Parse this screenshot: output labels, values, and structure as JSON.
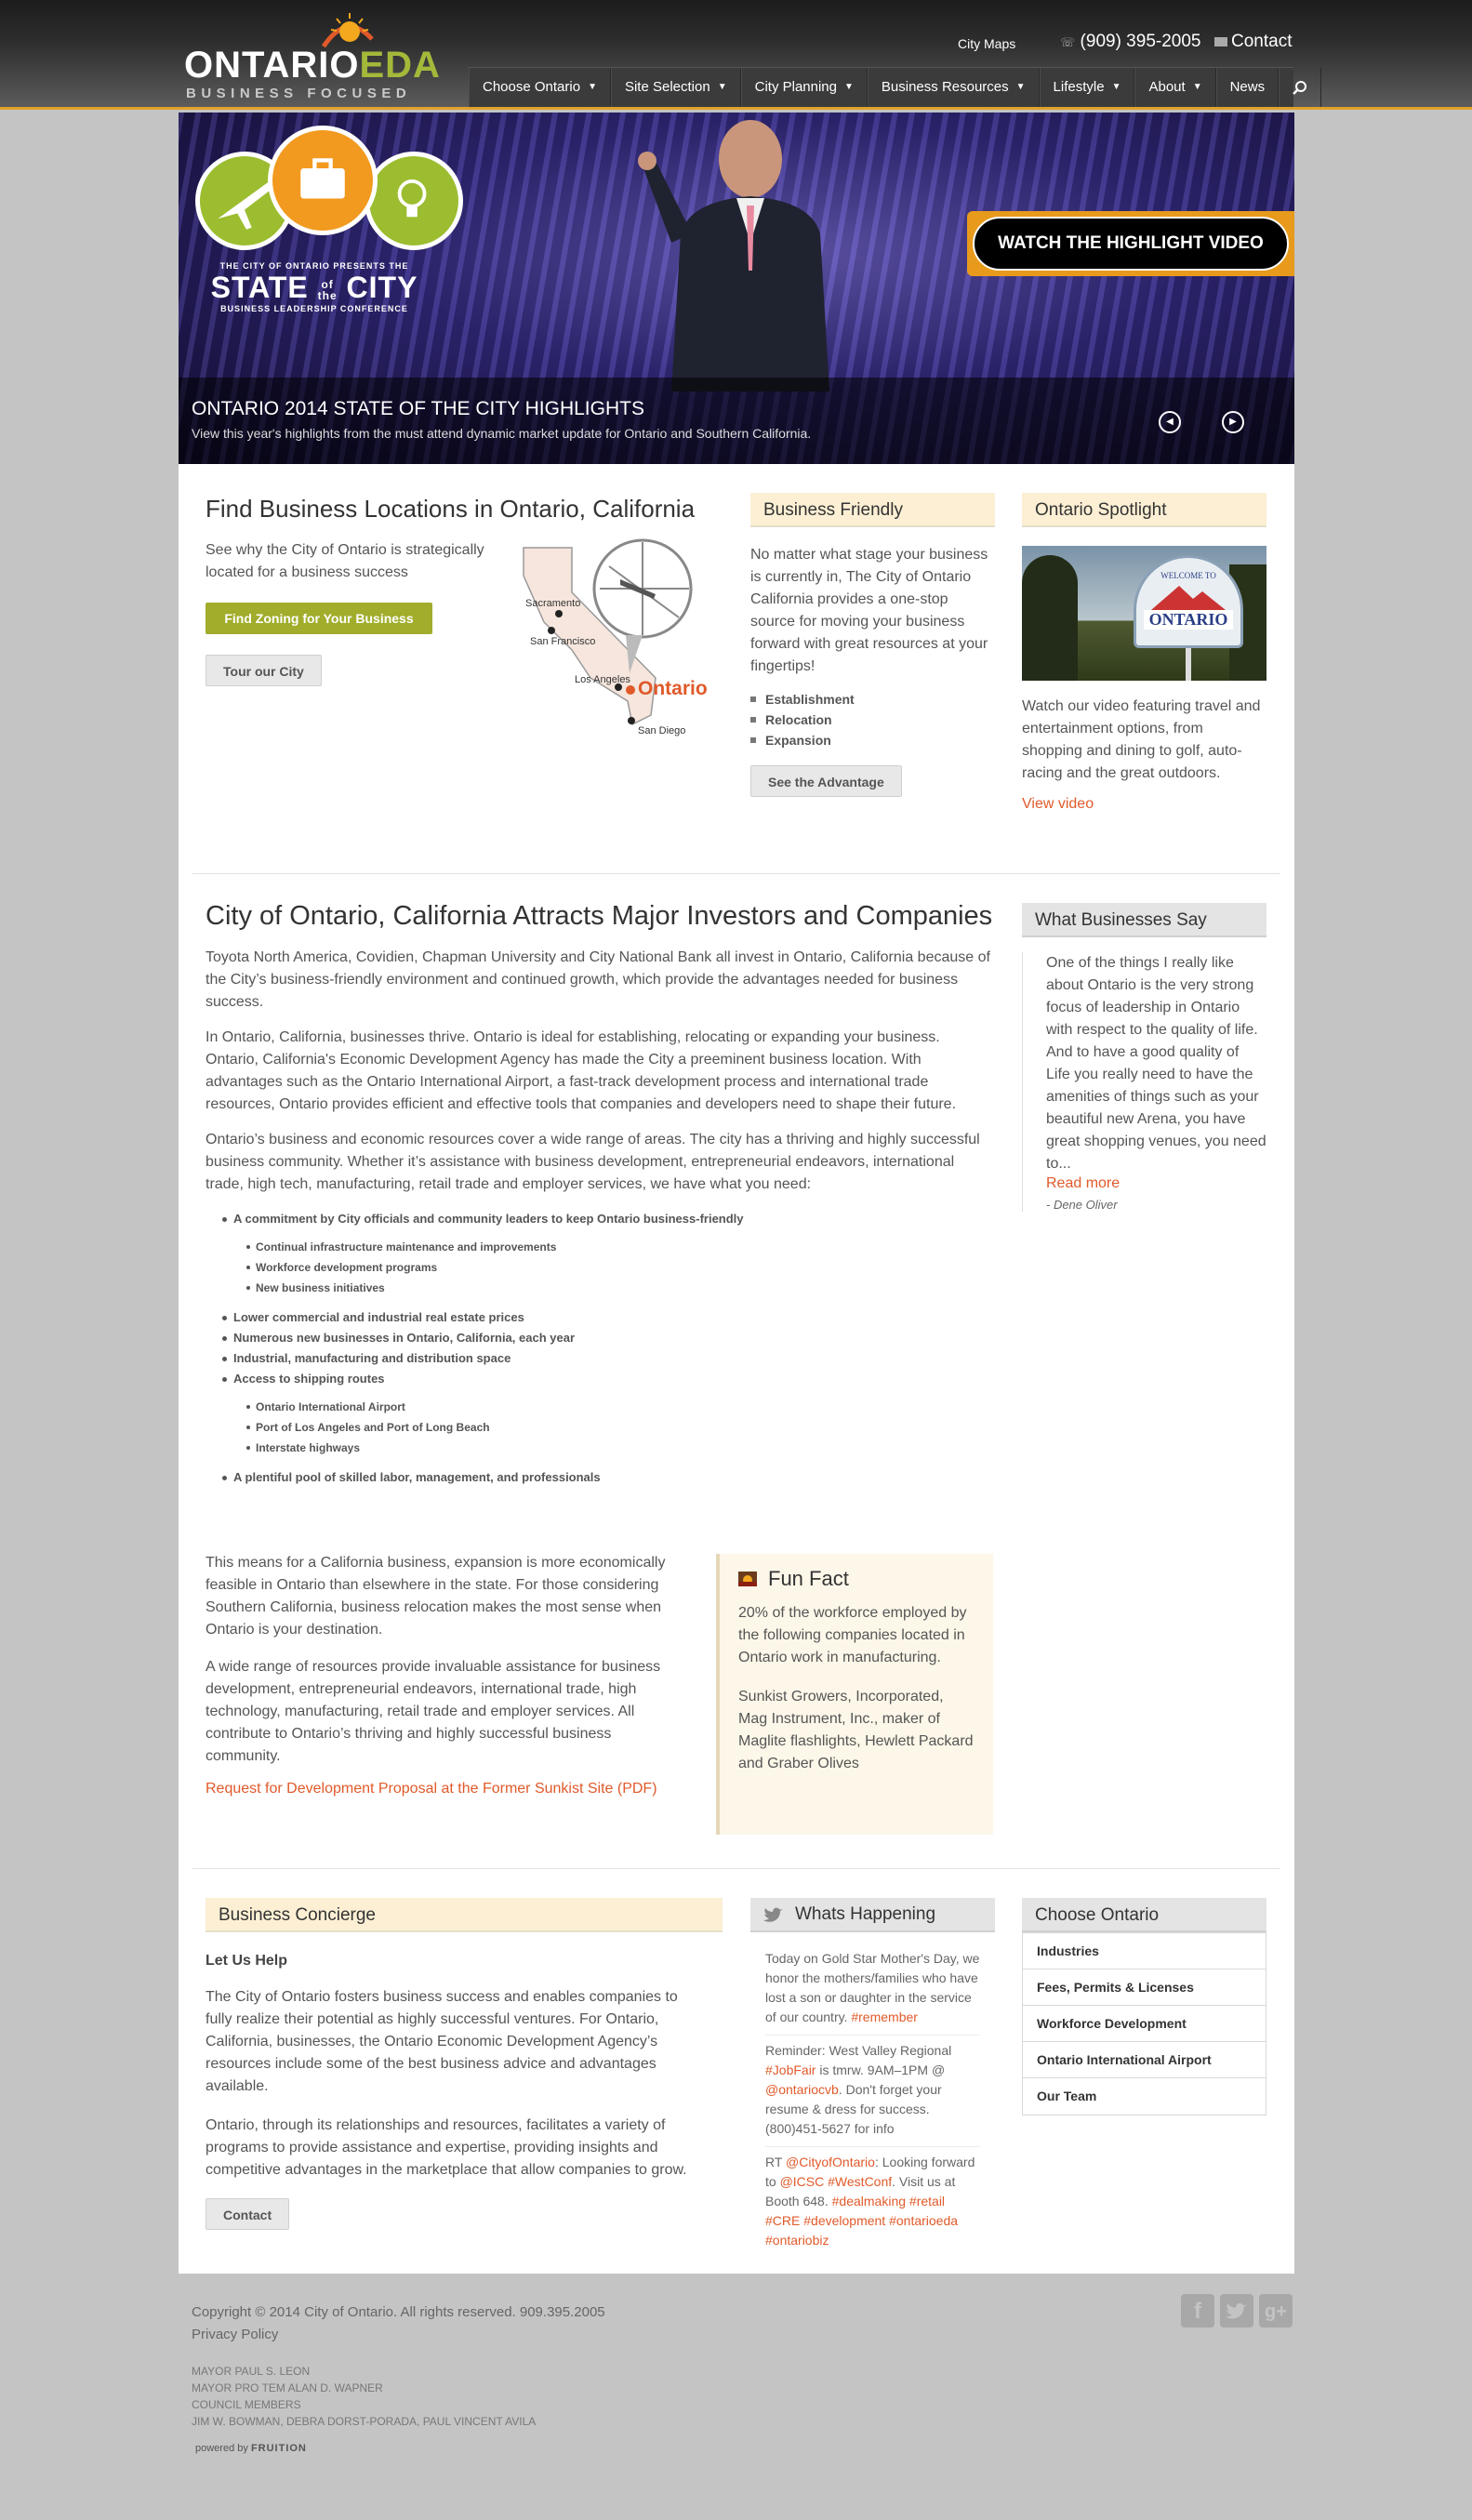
{
  "header": {
    "logo_main": "ONTARIO",
    "logo_accent": "EDA",
    "logo_tag": "BUSINESS FOCUSED",
    "city_maps": "City Maps",
    "phone": "(909) 395-2005",
    "contact": "Contact"
  },
  "nav": {
    "items": [
      {
        "label": "Choose Ontario",
        "dropdown": true
      },
      {
        "label": "Site Selection",
        "dropdown": true
      },
      {
        "label": "City Planning",
        "dropdown": true
      },
      {
        "label": "Business Resources",
        "dropdown": true
      },
      {
        "label": "Lifestyle",
        "dropdown": true
      },
      {
        "label": "About",
        "dropdown": true
      },
      {
        "label": "News",
        "dropdown": false
      }
    ],
    "search_icon": "search-icon"
  },
  "hero": {
    "sotc_small": "THE CITY OF ONTARIO PRESENTS THE",
    "sotc_big_1": "STATE",
    "sotc_of": "of",
    "sotc_the": "the",
    "sotc_big_2": "CITY",
    "sotc_sub": "BUSINESS LEADERSHIP CONFERENCE",
    "watch_button": "WATCH THE HIGHLIGHT VIDEO",
    "caption_title": "ONTARIO 2014 STATE OF THE CITY HIGHLIGHTS",
    "caption_sub": "View this year's highlights from the must attend dynamic market update for Ontario and Southern California."
  },
  "locations": {
    "title": "Find Business Locations in Ontario, California",
    "text": "See why the City of Ontario is strategically located for a business success",
    "zoning_button": "Find Zoning for Your Business",
    "tour_button": "Tour our City",
    "map_labels": {
      "sacramento": "Sacramento",
      "san_francisco": "San Francisco",
      "los_angeles": "Los Angeles",
      "ontario": "Ontario",
      "san_diego": "San Diego"
    }
  },
  "business_friendly": {
    "title": "Business Friendly",
    "text": "No matter what stage your business is currently in, The City of Ontario California provides a one-stop source for moving your business forward with great resources at your fingertips!",
    "items": [
      "Establishment",
      "Relocation",
      "Expansion"
    ],
    "button": "See the Advantage"
  },
  "spotlight": {
    "title": "Ontario Spotlight",
    "sign_top": "WELCOME TO",
    "sign_main": "ONTARIO",
    "text": "Watch our video featuring travel and entertainment options, from shopping and dining to golf, auto-racing and the great outdoors.",
    "link": "View video"
  },
  "main": {
    "title": "City of Ontario, California Attracts Major Investors and Companies",
    "p1": "Toyota North America, Covidien, Chapman University and City National Bank all invest in Ontario, California because of the City’s business-friendly environment and continued growth, which provide the advantages needed for business success.",
    "p2": "In Ontario, California, businesses thrive. Ontario is ideal for establishing, relocating or expanding your business. Ontario, California's Economic Development Agency has made the City a preeminent business location. With advantages such as the Ontario International Airport, a fast-track development process and international trade resources, Ontario provides efficient and effective tools that companies and developers need to shape their future.",
    "p3": "Ontario’s business and economic resources cover a wide range of areas. The city has a thriving and highly successful business community. Whether it’s assistance with business development, entrepreneurial endeavors, international trade, high tech, manufacturing, retail trade and employer services, we have what you need:",
    "bullets": {
      "b1": "A commitment by City officials and community leaders to keep Ontario business-friendly",
      "b1_sub": [
        "Continual infrastructure maintenance and improvements",
        "Workforce development programs",
        "New business initiatives"
      ],
      "b2": "Lower commercial and industrial real estate prices",
      "b3": "Numerous new businesses in Ontario, California, each year",
      "b4": "Industrial, manufacturing and distribution space",
      "b5": "Access to shipping routes",
      "b5_sub": [
        "Ontario International Airport",
        "Port of Los Angeles and Port of Long Beach",
        "Interstate highways"
      ],
      "b6": "A plentiful pool of skilled labor, management, and professionals"
    },
    "p4": " This means for a California business, expansion is more economically feasible in Ontario than elsewhere in the state. For those considering Southern California, business relocation makes the most sense when Ontario is your destination.",
    "p5": "A wide range of resources provide invaluable assistance for business development, entrepreneurial endeavors, international trade, high technology, manufacturing, retail trade and employer services. All contribute to Ontario’s thriving and highly successful business community.",
    "pdf_link": "Request for Development Proposal at the Former Sunkist Site (PDF)"
  },
  "fun_fact": {
    "title": "Fun Fact",
    "p1": "20% of the workforce employed by the following companies located in Ontario work in manufacturing.",
    "p2": "Sunkist Growers, Incorporated, Mag Instrument, Inc., maker of Maglite flashlights, Hewlett Packard and Graber Olives"
  },
  "testimonial": {
    "title": "What Businesses Say",
    "quote": "One of the things I really like about Ontario is the very strong focus of leadership in Ontario with respect to the quality of life. And to have a good quality of Life you really need to have the amenities of things such as your beautiful new Arena, you have great shopping venues, you need to...",
    "read_more": "Read more",
    "author": "- Dene Oliver"
  },
  "concierge": {
    "title": "Business Concierge",
    "subtitle": "Let Us Help",
    "p1": "The City of Ontario fosters business success and enables companies to fully realize their potential as highly successful ventures. For Ontario, California, businesses, the Ontario Economic Development Agency’s resources include some of the best business advice and advantages available.",
    "p2": "Ontario, through its relationships and resources, facilitates a variety of programs to provide assistance and expertise, providing insights and competitive advantages in the marketplace that allow companies to grow.",
    "button": "Contact"
  },
  "happening": {
    "title": "Whats Happening",
    "t1_a": "Today on Gold Star Mother's Day, we honor the mothers/families who have lost a son or daughter in the service of our country. ",
    "t1_tag": "#remember",
    "t2_a": "Reminder: West Valley Regional ",
    "t2_tag1": "#JobFair",
    "t2_b": " is tmrw. 9AM–1PM @ ",
    "t2_tag2": "@ontariocvb",
    "t2_c": ". Don't forget your resume & dress for success. (800)451-5627 for info",
    "t3_a": "RT ",
    "t3_tag1": "@CityofOntario",
    "t3_b": ": Looking forward to ",
    "t3_tag2": "@ICSC",
    "t3_tag3": "#WestConf",
    "t3_c": ". Visit us at Booth 648. ",
    "t3_tag4": "#dealmaking",
    "t3_tag5": "#retail",
    "t3_tag6": "#CRE",
    "t3_tag7": "#development",
    "t3_tag8": "#ontarioeda",
    "t3_tag9": "#ontariobiz"
  },
  "choose_ontario": {
    "title": "Choose Ontario",
    "items": [
      "Industries",
      "Fees, Permits & Licenses",
      "Workforce Development",
      "Ontario International Airport",
      "Our Team"
    ]
  },
  "footer": {
    "copyright": "Copyright © 2014 City of Ontario. All rights reserved. 909.395.2005",
    "privacy": "Privacy Policy",
    "mayor": "MAYOR PAUL S. LEON",
    "pro_tem": "MAYOR PRO TEM ALAN D. WAPNER",
    "council": "COUNCIL MEMBERS",
    "members": "JIM W. BOWMAN, DEBRA DORST-PORADA, PAUL VINCENT AVILA",
    "powered_by": "powered by",
    "powered_brand": "FRUITION"
  },
  "colors": {
    "accent_orange": "#e05a2a",
    "accent_green": "#a1ad2b",
    "nav_bg": "#3b3b3b",
    "gold_bar": "#e0a229"
  }
}
